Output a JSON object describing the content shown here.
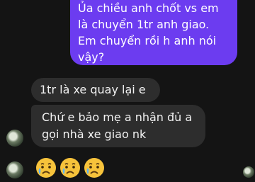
{
  "thread": {
    "sent_message": {
      "lines": [
        "Ủa chiều anh chốt vs em",
        "là chuyển 1tr anh giao.",
        "Em chuyển rồi h anh nói",
        "vậy?"
      ]
    },
    "received_1": {
      "lines": [
        "1tr là xe quay lại e"
      ]
    },
    "received_2": {
      "lines": [
        "Chứ e bảo mẹ a nhận đủ a",
        "gọi nhà xe giao nk"
      ]
    },
    "reaction_emojis": [
      "crying-face",
      "crying-face",
      "crying-face"
    ]
  },
  "colors": {
    "sent_bubble": "#6c3cf0",
    "received_bubble": "#2d2d2d",
    "background": "#141414"
  }
}
